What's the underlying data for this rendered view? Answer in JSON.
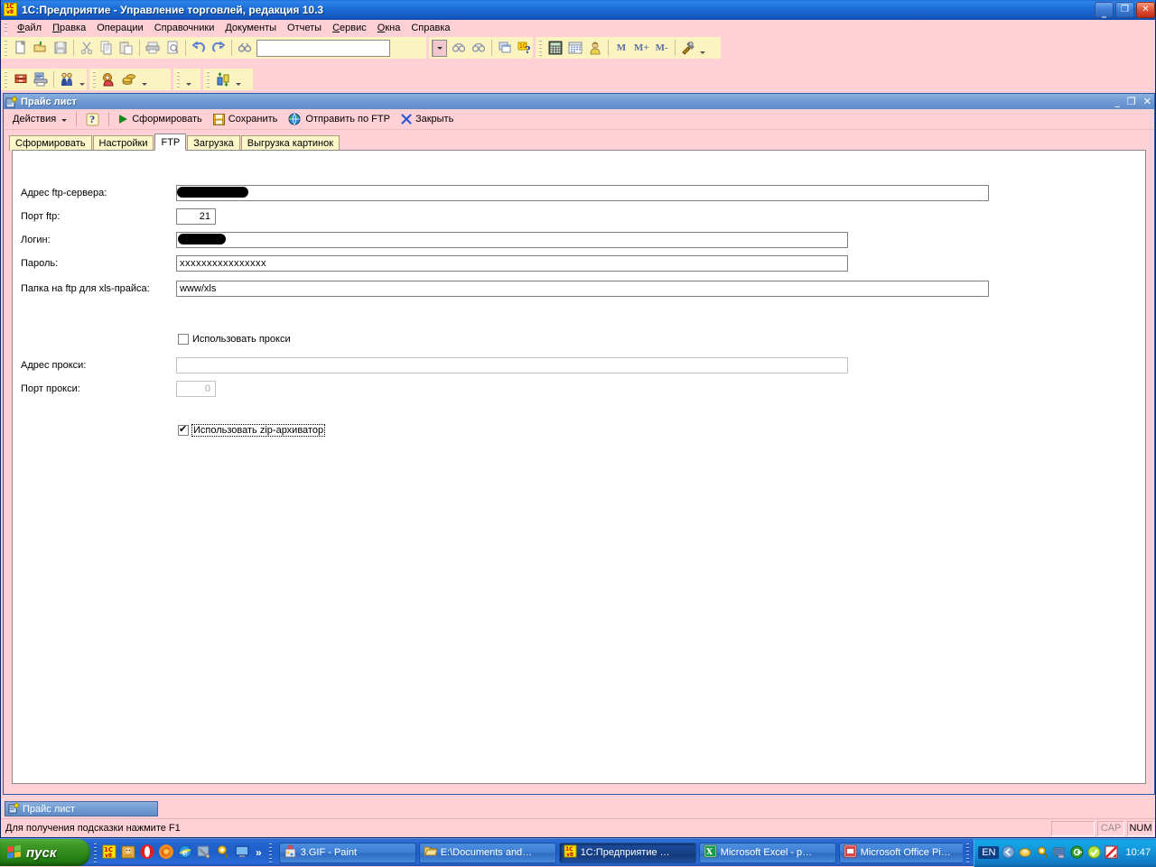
{
  "main_window": {
    "title": "1С:Предприятие - Управление торговлей, редакция 10.3",
    "icon": "1c-v8-icon",
    "buttons": {
      "minimize": "_",
      "restore": "❐",
      "close": "✕"
    }
  },
  "menubar": {
    "items": [
      {
        "label": "Файл",
        "accel": "Ф"
      },
      {
        "label": "Правка",
        "accel": "П"
      },
      {
        "label": "Операции",
        "accel": ""
      },
      {
        "label": "Справочники",
        "accel": ""
      },
      {
        "label": "Документы",
        "accel": ""
      },
      {
        "label": "Отчеты",
        "accel": ""
      },
      {
        "label": "Сервис",
        "accel": "С"
      },
      {
        "label": "Окна",
        "accel": "О"
      },
      {
        "label": "Справка",
        "accel": ""
      }
    ]
  },
  "toolbar_row1": {
    "buttons": [
      {
        "name": "new-document-icon",
        "tip": "Новый"
      },
      {
        "name": "open-folder-icon",
        "tip": "Открыть"
      },
      {
        "name": "save-disk-icon",
        "tip": "Сохранить"
      },
      {
        "name": "cut-scissors-icon",
        "tip": "Вырезать"
      },
      {
        "name": "copy-icon",
        "tip": "Копировать"
      },
      {
        "name": "paste-icon",
        "tip": "Вставить"
      },
      {
        "name": "print-icon",
        "tip": "Печать"
      },
      {
        "name": "print-preview-icon",
        "tip": "Предварительный просмотр"
      },
      {
        "name": "undo-icon",
        "tip": "Отменить"
      },
      {
        "name": "redo-icon",
        "tip": "Вернуть"
      },
      {
        "name": "find-binoculars-icon",
        "tip": "Найти"
      }
    ],
    "search_value": "",
    "search_placeholder": "",
    "nav_buttons": [
      {
        "name": "find-previous-icon"
      },
      {
        "name": "find-next-icon"
      },
      {
        "name": "windows-cascade-icon"
      },
      {
        "name": "help-1c-icon"
      }
    ],
    "tools": [
      {
        "name": "calculator-icon"
      },
      {
        "name": "calendar-icon"
      },
      {
        "name": "user-info-icon"
      }
    ],
    "memory_buttons": [
      {
        "label": "M"
      },
      {
        "label": "M+"
      },
      {
        "label": "M-"
      }
    ],
    "settings": {
      "name": "tools-hammer-wrench-icon"
    }
  },
  "toolbar_row2": {
    "group1": [
      {
        "name": "catalog-drawer-icon"
      },
      {
        "name": "reports-printer-icon"
      },
      {
        "name": "contractors-people-icon"
      }
    ],
    "group2": [
      {
        "name": "cash-register-icon"
      },
      {
        "name": "coins-money-icon"
      }
    ],
    "group3": [],
    "group4": [
      {
        "name": "exchange-arrows-icon"
      }
    ]
  },
  "child_window": {
    "title": "Прайс лист",
    "icon": "report-form-icon",
    "buttons": {
      "minimize": "_",
      "restore": "❐",
      "close": "✕"
    },
    "actionbar": [
      {
        "name": "actions-menu",
        "label": "Действия",
        "icon": "dropdown-caret",
        "has_caret": true
      },
      {
        "name": "help-button",
        "label": "",
        "icon": "question-help-icon"
      },
      {
        "name": "generate-button",
        "label": "Сформировать",
        "icon": "green-play-icon"
      },
      {
        "name": "save-button",
        "label": "Сохранить",
        "icon": "floppy-save-icon"
      },
      {
        "name": "send-ftp-button",
        "label": "Отправить по FTP",
        "icon": "globe-network-icon"
      },
      {
        "name": "close-button",
        "label": "Закрыть",
        "icon": "blue-x-icon"
      }
    ],
    "tabs": [
      {
        "label": "Сформировать",
        "active": false
      },
      {
        "label": "Настройки",
        "active": false
      },
      {
        "label": "FTP",
        "active": true
      },
      {
        "label": "Загрузка",
        "active": false
      },
      {
        "label": "Выгрузка картинок",
        "active": false
      }
    ]
  },
  "form": {
    "fields": [
      {
        "name": "ftp-server-address",
        "label": "Адрес ftp-сервера:",
        "value": "",
        "redacted": true,
        "disabled": false
      },
      {
        "name": "ftp-port",
        "label": "Порт ftp:",
        "value": "21",
        "redacted": false,
        "disabled": false
      },
      {
        "name": "ftp-login",
        "label": "Логин:",
        "value": "",
        "redacted": true,
        "disabled": false
      },
      {
        "name": "ftp-password",
        "label": "Пароль:",
        "value": "xxxxxxxxxxxxxxxx",
        "redacted": false,
        "disabled": false
      },
      {
        "name": "ftp-xls-folder",
        "label": "Папка на ftp для xls-прайса:",
        "value": "www/xls",
        "redacted": false,
        "disabled": false
      }
    ],
    "use_proxy": {
      "name": "use-proxy-checkbox",
      "label": "Использовать прокси",
      "checked": false
    },
    "proxy_address": {
      "name": "proxy-address",
      "label": "Адрес прокси:",
      "value": "",
      "disabled": true
    },
    "proxy_port": {
      "name": "proxy-port",
      "label": "Порт прокси:",
      "value": "0",
      "disabled": true
    },
    "use_zip": {
      "name": "use-zip-checkbox",
      "label": "Использовать zip-архиватор",
      "checked": true,
      "focused": true
    }
  },
  "mdi_taskstrip": {
    "buttons": [
      {
        "label": "Прайс лист",
        "icon": "report-form-icon",
        "active": true
      }
    ]
  },
  "statusbar": {
    "message": "Для получения подсказки нажмите F1",
    "panes": [
      {
        "name": "status-pane-blank",
        "label": ""
      },
      {
        "name": "caps-lock-indicator",
        "label": "CAP",
        "dim": true
      },
      {
        "name": "num-lock-indicator",
        "label": "NUM",
        "dim": false
      }
    ]
  },
  "taskbar": {
    "start_label": "пуск",
    "quicklaunch": [
      {
        "name": "1c-enterprise-icon"
      },
      {
        "name": "1c-config-icon"
      },
      {
        "name": "opera-browser-icon"
      },
      {
        "name": "firefox-browser-icon"
      },
      {
        "name": "internet-explorer-icon"
      },
      {
        "name": "tools-config-icon"
      },
      {
        "name": "winamp-icon"
      },
      {
        "name": "show-desktop-icon"
      }
    ],
    "more_chevron": "»",
    "tasks": [
      {
        "name": "task-paint",
        "label": "3.GIF - Paint",
        "icon": "paint-icon",
        "active": false
      },
      {
        "name": "task-explorer",
        "label": "E:\\Documents and…",
        "icon": "folder-icon",
        "active": false
      },
      {
        "name": "task-1c",
        "label": "1С:Предприятие …",
        "icon": "1c-v8-icon",
        "active": true
      },
      {
        "name": "task-excel",
        "label": "Microsoft Excel - p…",
        "icon": "excel-icon",
        "active": false
      },
      {
        "name": "task-picture-manager",
        "label": "Microsoft Office Pi…",
        "icon": "office-picture-icon",
        "active": false
      }
    ],
    "language": "EN",
    "tray": [
      {
        "name": "safely-remove-icon"
      },
      {
        "name": "volume-icon"
      },
      {
        "name": "winamp-tray-icon"
      },
      {
        "name": "network-connection-icon"
      },
      {
        "name": "antivirus-green-icon"
      },
      {
        "name": "shield-yellow-icon"
      },
      {
        "name": "update-red-icon"
      }
    ],
    "clock": "10:47"
  },
  "colors": {
    "title_blue": "#1c6fd8",
    "app_pink": "#ffd0d6",
    "toolbar_yellow": "#fcf4c0",
    "tab_yellow": "#fdf6c8",
    "child_title_blue": "#6f9ad2",
    "start_green": "#2f8a1c",
    "taskbar_blue": "#1e5ec9"
  }
}
